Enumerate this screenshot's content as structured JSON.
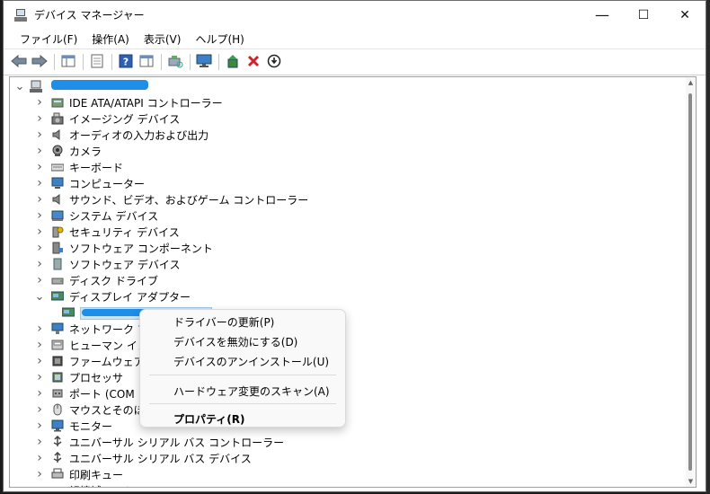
{
  "window": {
    "title": "デバイス マネージャー",
    "min_glyph": "—",
    "max_glyph": "☐",
    "close_glyph": "✕"
  },
  "menubar": [
    {
      "label": "ファイル(F)",
      "name": "menu-file"
    },
    {
      "label": "操作(A)",
      "name": "menu-action"
    },
    {
      "label": "表示(V)",
      "name": "menu-view"
    },
    {
      "label": "ヘルプ(H)",
      "name": "menu-help"
    }
  ],
  "toolbar": [
    {
      "name": "back-arrow-icon"
    },
    {
      "name": "forward-arrow-icon"
    },
    {
      "sep": true
    },
    {
      "name": "show-hide-tree-icon"
    },
    {
      "sep": true
    },
    {
      "name": "properties-icon"
    },
    {
      "sep": true
    },
    {
      "name": "help-icon"
    },
    {
      "name": "action-pane-icon"
    },
    {
      "sep": true
    },
    {
      "name": "scan-hardware-icon"
    },
    {
      "sep": true
    },
    {
      "name": "monitor-icon"
    },
    {
      "sep": true
    },
    {
      "name": "update-driver-icon"
    },
    {
      "name": "uninstall-x-icon"
    },
    {
      "name": "disable-device-icon"
    }
  ],
  "tree": {
    "root_label": "",
    "items": [
      {
        "label": "IDE ATA/ATAPI コントローラー",
        "icon": "ide-controller-icon",
        "expanded": false
      },
      {
        "label": "イメージング デバイス",
        "icon": "camera-imaging-icon",
        "expanded": false
      },
      {
        "label": "オーディオの入力および出力",
        "icon": "speaker-icon",
        "expanded": false
      },
      {
        "label": "カメラ",
        "icon": "webcam-icon",
        "expanded": false
      },
      {
        "label": "キーボード",
        "icon": "keyboard-icon",
        "expanded": false
      },
      {
        "label": "コンピューター",
        "icon": "computer-icon",
        "expanded": false
      },
      {
        "label": "サウンド、ビデオ、およびゲーム コントローラー",
        "icon": "sound-icon",
        "expanded": false
      },
      {
        "label": "システム デバイス",
        "icon": "system-device-icon",
        "expanded": false
      },
      {
        "label": "セキュリティ デバイス",
        "icon": "security-key-icon",
        "expanded": false
      },
      {
        "label": "ソフトウェア コンポーネント",
        "icon": "software-component-icon",
        "expanded": false
      },
      {
        "label": "ソフトウェア デバイス",
        "icon": "software-device-icon",
        "expanded": false
      },
      {
        "label": "ディスク ドライブ",
        "icon": "disk-drive-icon",
        "expanded": false
      },
      {
        "label": "ディスプレイ アダプター",
        "icon": "display-adapter-icon",
        "expanded": true
      },
      {
        "label": "",
        "icon": "display-adapter-icon",
        "child": true
      },
      {
        "label": "ネットワーク アダプター",
        "icon": "network-adapter-icon",
        "expanded": false
      },
      {
        "label": "ヒューマン インターフェイス デバイス",
        "icon": "hid-icon",
        "expanded": false
      },
      {
        "label": "ファームウェア",
        "icon": "firmware-icon",
        "expanded": false
      },
      {
        "label": "プロセッサ",
        "icon": "processor-icon",
        "expanded": false
      },
      {
        "label": "ポート (COM と LPT)",
        "icon": "port-icon",
        "expanded": false
      },
      {
        "label": "マウスとそのほかのポインティング デバイス",
        "icon": "mouse-icon",
        "expanded": false
      },
      {
        "label": "モニター",
        "icon": "monitor-icon",
        "expanded": false
      },
      {
        "label": "ユニバーサル シリアル バス コントローラー",
        "icon": "usb-controller-icon",
        "expanded": false
      },
      {
        "label": "ユニバーサル シリアル バス デバイス",
        "icon": "usb-device-icon",
        "expanded": false
      },
      {
        "label": "印刷キュー",
        "icon": "printer-icon",
        "expanded": false
      },
      {
        "label": "記憶域コントローラー",
        "icon": "storage-controller-icon",
        "expanded": false
      }
    ]
  },
  "context_menu": {
    "items": [
      {
        "label": "ドライバーの更新(P)",
        "name": "ctx-update-driver"
      },
      {
        "label": "デバイスを無効にする(D)",
        "name": "ctx-disable-device"
      },
      {
        "label": "デバイスのアンインストール(U)",
        "name": "ctx-uninstall-device"
      },
      {
        "sep": true
      },
      {
        "label": "ハードウェア変更のスキャン(A)",
        "name": "ctx-scan-hardware"
      },
      {
        "sep": true
      },
      {
        "label": "プロパティ(R)",
        "name": "ctx-properties",
        "bold": true
      }
    ]
  },
  "colors": {
    "accent": "#1e8ee8",
    "menu_bg": "#f9f9f9",
    "tree_border": "#a0a0a0"
  }
}
